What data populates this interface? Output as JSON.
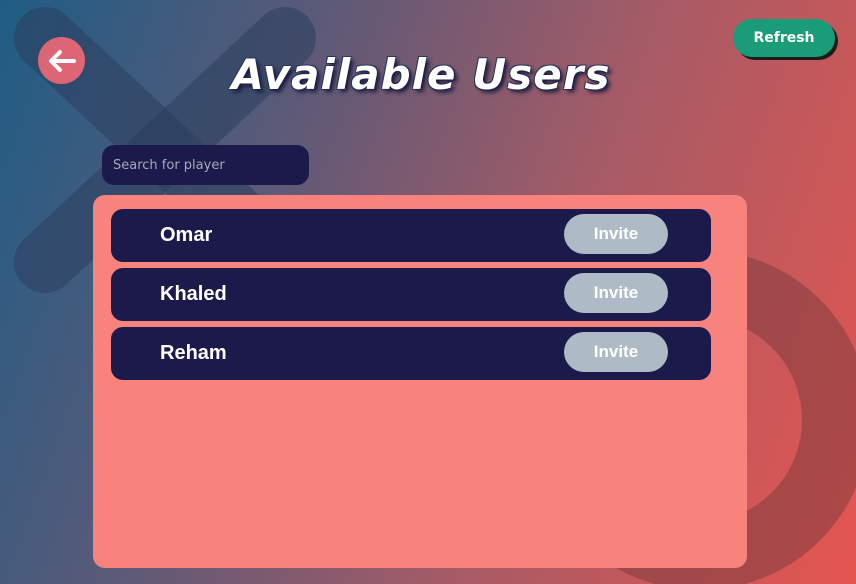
{
  "header": {
    "title": "Available Users",
    "back_icon": "arrow-left-icon",
    "refresh_label": "Refresh"
  },
  "search": {
    "placeholder": "Search for player",
    "value": ""
  },
  "users": [
    {
      "name": "Omar",
      "invite_label": "Invite"
    },
    {
      "name": "Khaled",
      "invite_label": "Invite"
    },
    {
      "name": "Reham",
      "invite_label": "Invite"
    }
  ],
  "colors": {
    "panel": "#f8827c",
    "row": "#1b1a4b",
    "invite_button": "#aebbc6",
    "refresh_button": "#1a9c79",
    "back_button": "#dc6674"
  }
}
